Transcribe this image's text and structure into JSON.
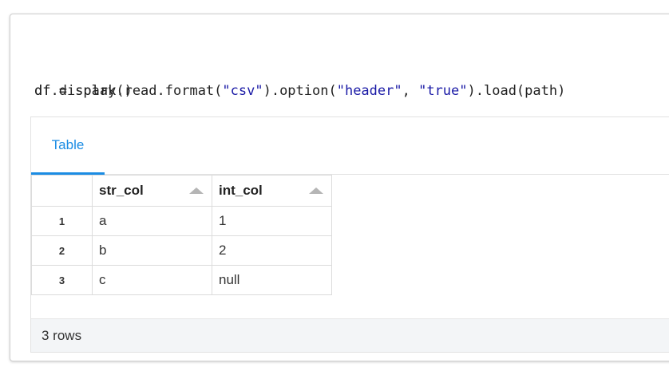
{
  "code": {
    "line1": {
      "prefix": "df = spark.read.format(",
      "fmt": "\"csv\"",
      "mid1": ").option(",
      "key": "\"header\"",
      "sep": ", ",
      "val": "\"true\"",
      "suffix": ").load(path)"
    },
    "line2": "df.display()"
  },
  "output": {
    "tab_label": "Table",
    "columns": [
      "str_col",
      "int_col"
    ],
    "rows": [
      {
        "index": "1",
        "str_col": "a",
        "int_col": "1"
      },
      {
        "index": "2",
        "str_col": "b",
        "int_col": "2"
      },
      {
        "index": "3",
        "str_col": "c",
        "int_col": "null"
      }
    ],
    "footer_text": "3 rows"
  },
  "colors": {
    "accent": "#1b8ce3",
    "string_literal": "#1a1aa6"
  },
  "icons": [
    "sort-up-icon"
  ]
}
